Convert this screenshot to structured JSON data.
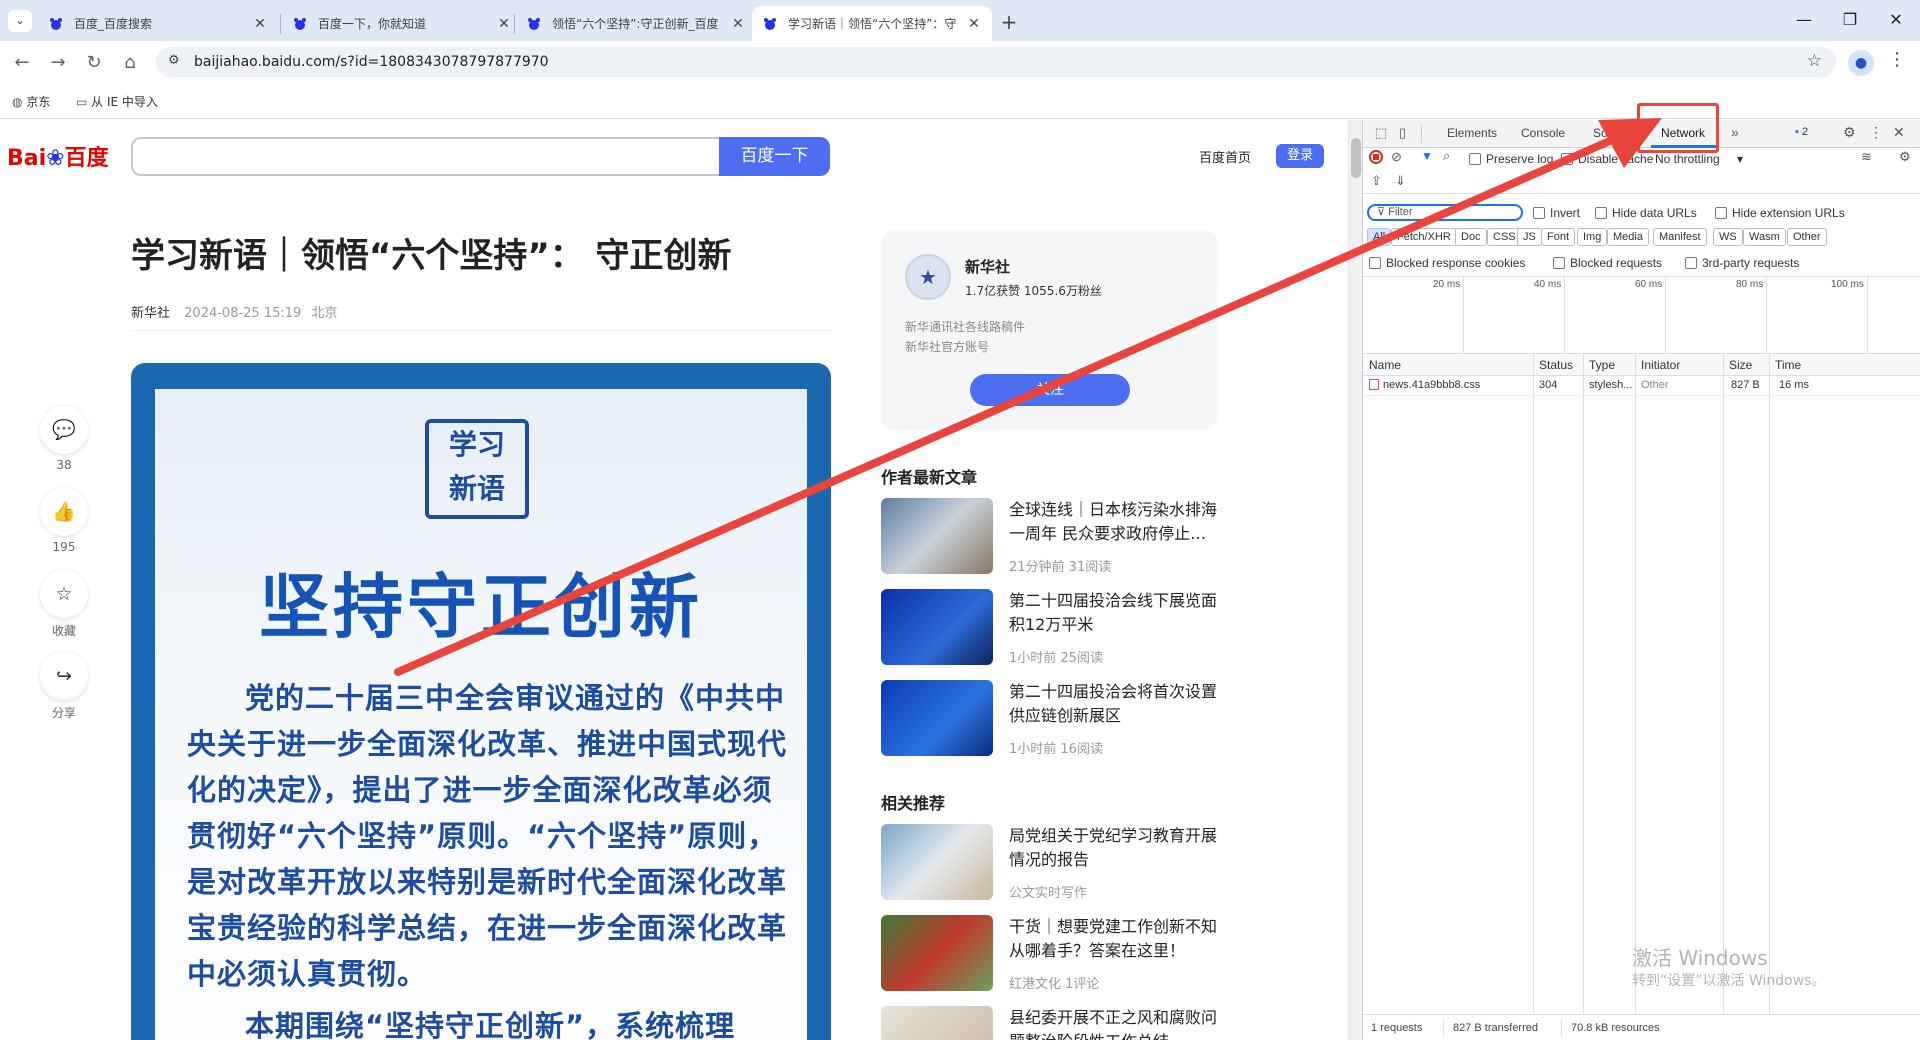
{
  "tabs": [
    {
      "title": "百度_百度搜索"
    },
    {
      "title": "百度一下，你就知道"
    },
    {
      "title": "领悟“六个坚持”:守正创新_百度"
    },
    {
      "title": "学习新语｜领悟“六个坚持”：守"
    }
  ],
  "new_tab": "+",
  "url": "baijiahao.baidu.com/s?id=1808343078797877970",
  "bookmarks": [
    {
      "label": "京东"
    },
    {
      "label": "从 IE 中导入"
    }
  ],
  "baidu": {
    "logo_text1": "Bai",
    "logo_text2": "百度",
    "search_button": "百度一下",
    "home_link": "百度首页",
    "login_button": "登录"
  },
  "article": {
    "title": "学习新语｜领悟“六个坚持”： 守正创新",
    "author": "新华社",
    "date": "2024-08-25 15:19",
    "location": "北京",
    "image_logo_line1": "学习",
    "image_logo_line2": "新语",
    "image_heading": "坚持守正创新",
    "image_body": "党的二十届三中全会审议通过的《中共中央关于进一步全面深化改革、推进中国式现代化的决定》，提出了进一步全面深化改革必须贯彻好“六个坚持”原则。“六个坚持”原则，是对改革开放以来特别是新时代全面深化改革宝贵经验的科学总结，在进一步全面深化改革中必须认真贯彻。",
    "image_body2": "本期围绕“坚持守正创新”，系统梳理"
  },
  "actions": [
    {
      "icon": "comment-icon",
      "label": "38"
    },
    {
      "icon": "like-icon",
      "label": "195"
    },
    {
      "icon": "star-icon",
      "label": "收藏"
    },
    {
      "icon": "share-icon",
      "label": "分享"
    }
  ],
  "author_card": {
    "name": "新华社",
    "stats": "1.7亿获赞 1055.6万粉丝",
    "desc1": "新华通讯社各线路稿件",
    "desc2": "新华社官方账号",
    "follow": "关注"
  },
  "latest_title": "作者最新文章",
  "latest": [
    {
      "title": "全球连线｜日本核污染水排海一周年 民众要求政府停止…",
      "meta": "21分钟前   31阅读"
    },
    {
      "title": "第二十四届投洽会线下展览面积12万平米",
      "meta": "1小时前   25阅读"
    },
    {
      "title": "第二十四届投洽会将首次设置供应链创新展区",
      "meta": "1小时前   16阅读"
    }
  ],
  "related_title": "相关推荐",
  "related": [
    {
      "title": "局党组关于党纪学习教育开展情况的报告",
      "meta": "公文实时写作"
    },
    {
      "title": "干货｜想要党建工作创新不知从哪着手？答案在这里！",
      "meta": "红港文化   1评论"
    },
    {
      "title": "县纪委开展不正之风和腐败问题整治阶段性工作总结",
      "meta": ""
    }
  ],
  "devtools": {
    "tabs": [
      "Elements",
      "Console",
      "Sources",
      "Network"
    ],
    "more": "»",
    "issues_count": "2",
    "preserve_log": "Preserve log",
    "disable_cache": "Disable cache",
    "throttling": "No throttling",
    "filter_placeholder": "Filter",
    "invert": "Invert",
    "hide_data_urls": "Hide data URLs",
    "hide_extension_urls": "Hide extension URLs",
    "type_filters": [
      "All",
      "Fetch/XHR",
      "Doc",
      "CSS",
      "JS",
      "Font",
      "Img",
      "Media",
      "Manifest",
      "WS",
      "Wasm",
      "Other"
    ],
    "blocked_cookies": "Blocked response cookies",
    "blocked_requests": "Blocked requests",
    "third_party": "3rd-party requests",
    "timeline_ticks": [
      "20 ms",
      "40 ms",
      "60 ms",
      "80 ms",
      "100 ms"
    ],
    "columns": [
      "Name",
      "Status",
      "Type",
      "Initiator",
      "Size",
      "Time"
    ],
    "rows": [
      {
        "name": "news.41a9bbb8.css",
        "status": "304",
        "type": "stylesh...",
        "initiator": "Other",
        "size": "827 B",
        "time": "16 ms"
      }
    ],
    "summary_requests": "1 requests",
    "summary_transferred": "827 B transferred",
    "summary_resources": "70.8 kB resources"
  },
  "watermark": {
    "line1": "激活 Windows",
    "line2": "转到“设置”以激活 Windows。"
  },
  "colors": {
    "annotation": "#e8463c",
    "baidu_blue": "#4e6ef2",
    "tabstrip": "#dfe8f7"
  }
}
